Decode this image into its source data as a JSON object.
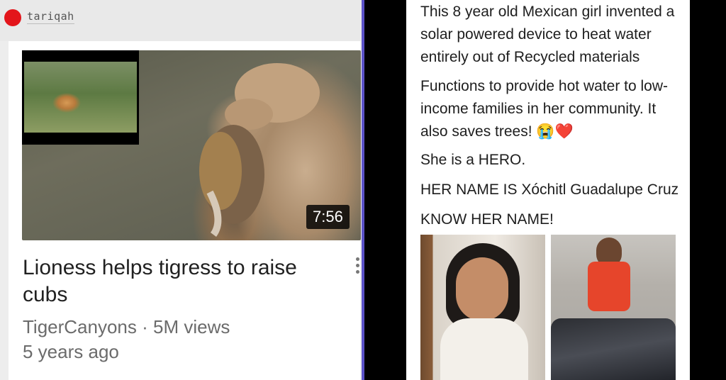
{
  "left_post": {
    "username": "tariqah",
    "video": {
      "duration": "7:56",
      "title": "Lioness helps tigress to raise cubs",
      "channel": "TigerCanyons",
      "views": "5M views",
      "separator": "·",
      "age": "5 years ago"
    }
  },
  "right_post": {
    "paragraphs": [
      "This 8 year old Mexican girl invented a solar powered device to heat water entirely out of Recycled materials",
      "Functions to provide hot water to low-income families in her community. It also saves trees! 😭❤️",
      "She is a HERO.",
      "HER NAME IS Xóchitl Guadalupe Cruz",
      "KNOW HER NAME!"
    ]
  },
  "colors": {
    "avatar": "#e3151b",
    "divider": "#5b52c8"
  }
}
